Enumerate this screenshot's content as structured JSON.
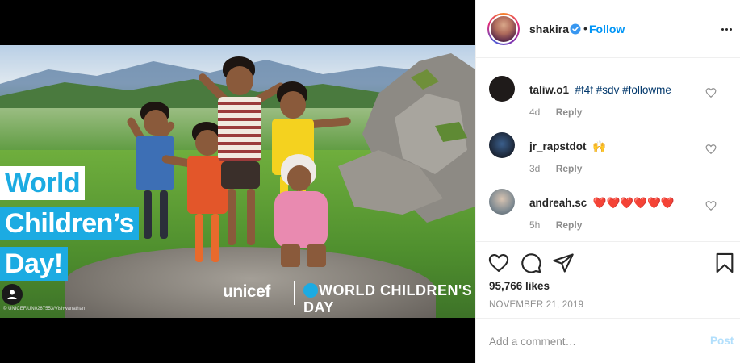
{
  "post": {
    "image_overlay": {
      "title_lines": [
        "World",
        "Children’s",
        "Day!"
      ],
      "brand": "unicef",
      "campaign": "WORLD CHILDREN'S DAY",
      "credit": "© UNICEF/UN0267553/Vishwanathan"
    },
    "author": {
      "username": "shakira",
      "verified": true,
      "follow_label": "Follow",
      "separator": "•"
    },
    "comments": [
      {
        "user": "taliw.o1",
        "text": "#f4f #sdv #followme",
        "time": "4d",
        "reply_label": "Reply",
        "avatar_color": "#1f1b1a"
      },
      {
        "user": "jr_rapstdot",
        "text": "🙌",
        "time": "3d",
        "reply_label": "Reply",
        "avatar_color": "#1b2433"
      },
      {
        "user": "andreah.sc",
        "text": "❤️❤️❤️❤️❤️❤️",
        "time": "5h",
        "reply_label": "Reply",
        "avatar_color": "#7f8a91"
      }
    ],
    "likes": "95,766 likes",
    "date": "NOVEMBER 21, 2019",
    "add_comment": {
      "placeholder": "Add a comment…",
      "post_label": "Post"
    },
    "icons": [
      "like-heart-icon",
      "comment-bubble-icon",
      "share-plane-icon",
      "save-bookmark-icon",
      "more-options-icon",
      "verified-badge-icon",
      "user-tag-icon"
    ],
    "colors": {
      "brand_blue": "#1cabe2",
      "follow_blue": "#0095f6",
      "post_disabled": "#b2dffc",
      "muted_text": "#8e8e8e"
    }
  }
}
